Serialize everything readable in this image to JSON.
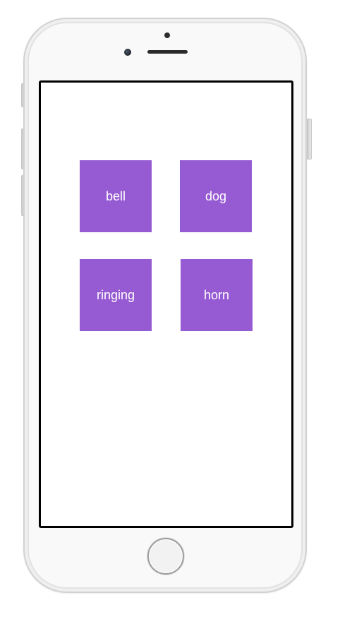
{
  "device": {
    "frame_color": "#f9f9f9",
    "screen_border_color": "#000000"
  },
  "app": {
    "tile_color": "#965ad2",
    "tile_text_color": "#ffffff",
    "tiles": [
      {
        "label": "bell"
      },
      {
        "label": "dog"
      },
      {
        "label": "ringing"
      },
      {
        "label": "horn"
      }
    ]
  }
}
